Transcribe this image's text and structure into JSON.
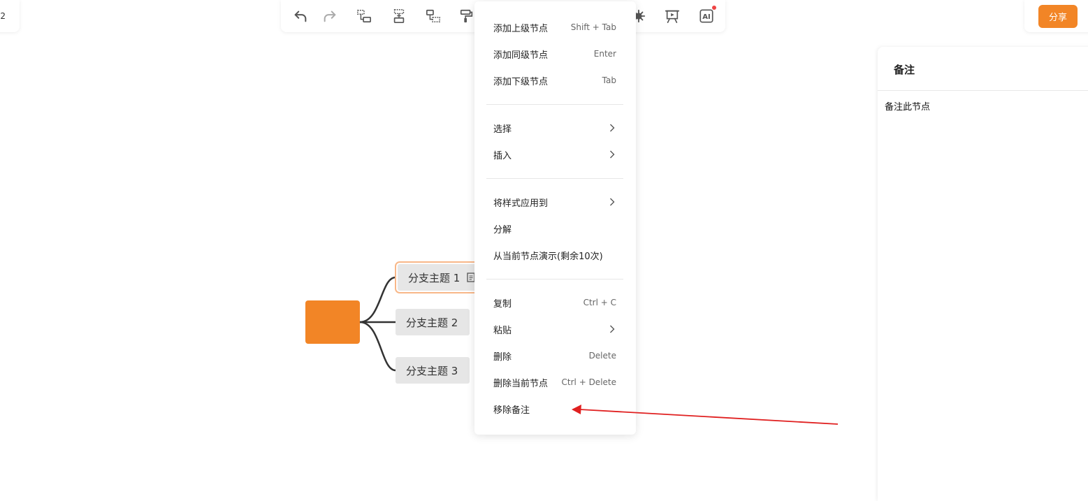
{
  "zoom": {
    "label": "2"
  },
  "toolbar": {
    "buttons": [
      {
        "name": "undo-icon"
      },
      {
        "name": "redo-icon"
      },
      {
        "name": "add-child-node-icon"
      },
      {
        "name": "add-sibling-node-icon"
      },
      {
        "name": "add-subnode-icon"
      },
      {
        "name": "format-painter-icon"
      },
      {
        "name": "settings-icon"
      },
      {
        "name": "presentation-icon"
      },
      {
        "name": "ai-icon",
        "text": "AI"
      }
    ]
  },
  "share": {
    "label": "分享"
  },
  "notes_panel": {
    "title": "备注",
    "content": "备注此节点"
  },
  "mindmap": {
    "branches": [
      {
        "label": "分支主题 1",
        "has_note": true,
        "selected": true
      },
      {
        "label": "分支主题 2",
        "has_note": false,
        "selected": false
      },
      {
        "label": "分支主题 3",
        "has_note": false,
        "selected": false
      }
    ]
  },
  "context_menu": {
    "items": [
      {
        "label": "添加上级节点",
        "shortcut": "Shift + Tab"
      },
      {
        "label": "添加同级节点",
        "shortcut": "Enter"
      },
      {
        "label": "添加下级节点",
        "shortcut": "Tab"
      },
      {
        "label": "选择",
        "submenu": true
      },
      {
        "label": "插入",
        "submenu": true
      },
      {
        "label": "将样式应用到",
        "submenu": true
      },
      {
        "label": "分解"
      },
      {
        "label": "从当前节点演示(剩余10次)"
      },
      {
        "label": "复制",
        "shortcut": "Ctrl + C"
      },
      {
        "label": "粘贴",
        "submenu": true
      },
      {
        "label": "删除",
        "shortcut": "Delete"
      },
      {
        "label": "删除当前节点",
        "shortcut": "Ctrl + Delete"
      },
      {
        "label": "移除备注"
      }
    ]
  },
  "colors": {
    "accent": "#f28526",
    "annotation_arrow": "#e02020"
  }
}
